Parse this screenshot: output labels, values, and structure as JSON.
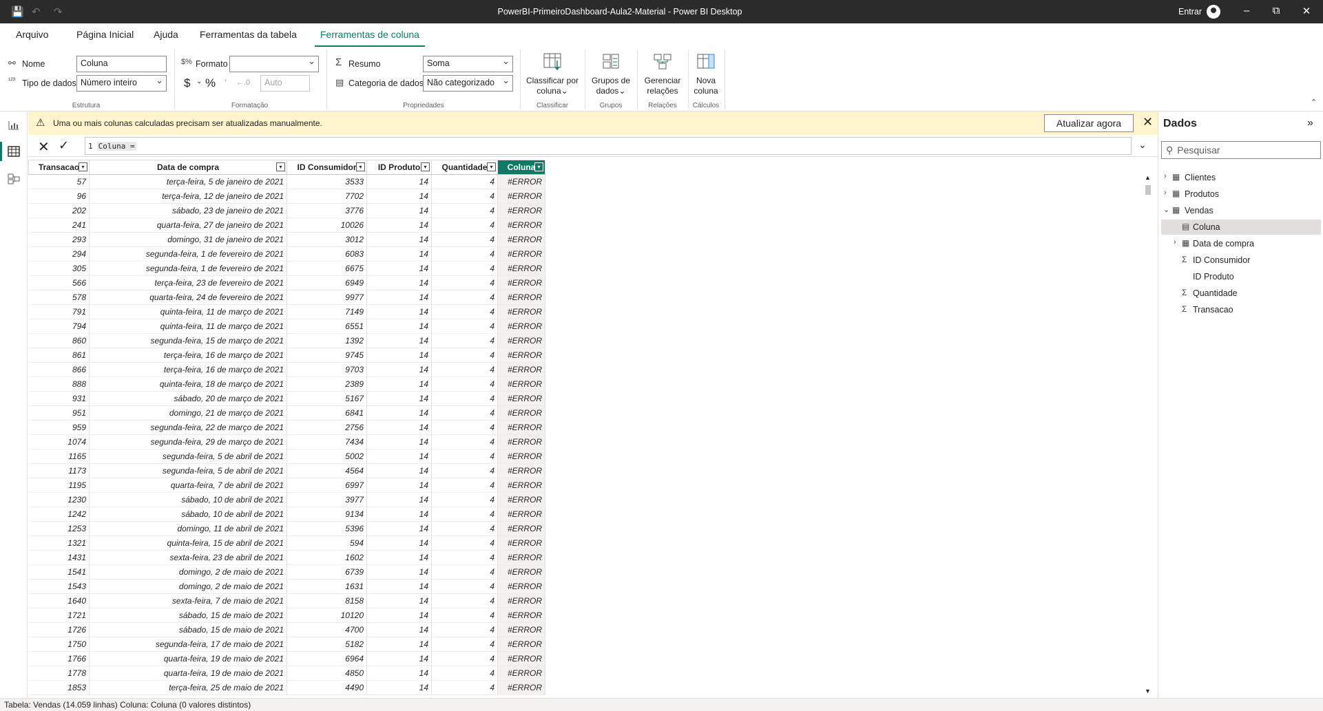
{
  "window": {
    "title": "PowerBI-PrimeiroDashboard-Aula2-Material - Power BI Desktop",
    "signin": "Entrar"
  },
  "tabs": [
    "Arquivo",
    "Página Inicial",
    "Ajuda",
    "Ferramentas da tabela",
    "Ferramentas de coluna"
  ],
  "ribbon": {
    "name_label": "Nome",
    "name_value": "Coluna",
    "datatype_label": "Tipo de dados",
    "datatype_value": "Número inteiro",
    "structure_label": "Estrutura",
    "format_label": "Formato",
    "format_value": "",
    "currency_symbol": "$",
    "percent_symbol": "%",
    "decimals_value": "Auto",
    "formatting_label": "Formatação",
    "summary_label": "Resumo",
    "summary_value": "Soma",
    "category_label": "Categoria de dados",
    "category_value": "Não categorizado",
    "properties_label": "Propriedades",
    "sort_btn_line1": "Classificar por",
    "sort_btn_line2": "coluna",
    "sort_group": "Classificar",
    "groups_btn_line1": "Grupos de",
    "groups_btn_line2": "dados",
    "groups_group": "Grupos",
    "rel_btn_line1": "Gerenciar",
    "rel_btn_line2": "relações",
    "rel_group": "Relações",
    "newcol_btn_line1": "Nova",
    "newcol_btn_line2": "coluna",
    "calc_group": "Cálculos"
  },
  "notice": {
    "message": "Uma ou mais colunas calculadas precisam ser atualizadas manualmente.",
    "button": "Atualizar agora"
  },
  "formula": {
    "line_number": "1",
    "expression": "Coluna ="
  },
  "table": {
    "headers": [
      "Transacao",
      "Data de compra",
      "ID Consumidor",
      "ID Produto",
      "Quantidade",
      "Coluna"
    ],
    "rows": [
      [
        "57",
        "terça-feira, 5 de janeiro de 2021",
        "3533",
        "14",
        "4",
        "#ERROR"
      ],
      [
        "96",
        "terça-feira, 12 de janeiro de 2021",
        "7702",
        "14",
        "4",
        "#ERROR"
      ],
      [
        "202",
        "sábado, 23 de janeiro de 2021",
        "3776",
        "14",
        "4",
        "#ERROR"
      ],
      [
        "241",
        "quarta-feira, 27 de janeiro de 2021",
        "10026",
        "14",
        "4",
        "#ERROR"
      ],
      [
        "293",
        "domingo, 31 de janeiro de 2021",
        "3012",
        "14",
        "4",
        "#ERROR"
      ],
      [
        "294",
        "segunda-feira, 1 de fevereiro de 2021",
        "6083",
        "14",
        "4",
        "#ERROR"
      ],
      [
        "305",
        "segunda-feira, 1 de fevereiro de 2021",
        "6675",
        "14",
        "4",
        "#ERROR"
      ],
      [
        "566",
        "terça-feira, 23 de fevereiro de 2021",
        "6949",
        "14",
        "4",
        "#ERROR"
      ],
      [
        "578",
        "quarta-feira, 24 de fevereiro de 2021",
        "9977",
        "14",
        "4",
        "#ERROR"
      ],
      [
        "791",
        "quinta-feira, 11 de março de 2021",
        "7149",
        "14",
        "4",
        "#ERROR"
      ],
      [
        "794",
        "quinta-feira, 11 de março de 2021",
        "6551",
        "14",
        "4",
        "#ERROR"
      ],
      [
        "860",
        "segunda-feira, 15 de março de 2021",
        "1392",
        "14",
        "4",
        "#ERROR"
      ],
      [
        "861",
        "terça-feira, 16 de março de 2021",
        "9745",
        "14",
        "4",
        "#ERROR"
      ],
      [
        "866",
        "terça-feira, 16 de março de 2021",
        "9703",
        "14",
        "4",
        "#ERROR"
      ],
      [
        "888",
        "quinta-feira, 18 de março de 2021",
        "2389",
        "14",
        "4",
        "#ERROR"
      ],
      [
        "931",
        "sábado, 20 de março de 2021",
        "5167",
        "14",
        "4",
        "#ERROR"
      ],
      [
        "951",
        "domingo, 21 de março de 2021",
        "6841",
        "14",
        "4",
        "#ERROR"
      ],
      [
        "959",
        "segunda-feira, 22 de março de 2021",
        "2756",
        "14",
        "4",
        "#ERROR"
      ],
      [
        "1074",
        "segunda-feira, 29 de março de 2021",
        "7434",
        "14",
        "4",
        "#ERROR"
      ],
      [
        "1165",
        "segunda-feira, 5 de abril de 2021",
        "5002",
        "14",
        "4",
        "#ERROR"
      ],
      [
        "1173",
        "segunda-feira, 5 de abril de 2021",
        "4564",
        "14",
        "4",
        "#ERROR"
      ],
      [
        "1195",
        "quarta-feira, 7 de abril de 2021",
        "6997",
        "14",
        "4",
        "#ERROR"
      ],
      [
        "1230",
        "sábado, 10 de abril de 2021",
        "3977",
        "14",
        "4",
        "#ERROR"
      ],
      [
        "1242",
        "sábado, 10 de abril de 2021",
        "9134",
        "14",
        "4",
        "#ERROR"
      ],
      [
        "1253",
        "domingo, 11 de abril de 2021",
        "5396",
        "14",
        "4",
        "#ERROR"
      ],
      [
        "1321",
        "quinta-feira, 15 de abril de 2021",
        "594",
        "14",
        "4",
        "#ERROR"
      ],
      [
        "1431",
        "sexta-feira, 23 de abril de 2021",
        "1602",
        "14",
        "4",
        "#ERROR"
      ],
      [
        "1541",
        "domingo, 2 de maio de 2021",
        "6739",
        "14",
        "4",
        "#ERROR"
      ],
      [
        "1543",
        "domingo, 2 de maio de 2021",
        "1631",
        "14",
        "4",
        "#ERROR"
      ],
      [
        "1640",
        "sexta-feira, 7 de maio de 2021",
        "8158",
        "14",
        "4",
        "#ERROR"
      ],
      [
        "1721",
        "sábado, 15 de maio de 2021",
        "10120",
        "14",
        "4",
        "#ERROR"
      ],
      [
        "1726",
        "sábado, 15 de maio de 2021",
        "4700",
        "14",
        "4",
        "#ERROR"
      ],
      [
        "1750",
        "segunda-feira, 17 de maio de 2021",
        "5182",
        "14",
        "4",
        "#ERROR"
      ],
      [
        "1766",
        "quarta-feira, 19 de maio de 2021",
        "6964",
        "14",
        "4",
        "#ERROR"
      ],
      [
        "1778",
        "quarta-feira, 19 de maio de 2021",
        "4850",
        "14",
        "4",
        "#ERROR"
      ],
      [
        "1853",
        "terça-feira, 25 de maio de 2021",
        "4490",
        "14",
        "4",
        "#ERROR"
      ]
    ]
  },
  "pane": {
    "title": "Dados",
    "search_placeholder": "Pesquisar",
    "tables": [
      "Clientes",
      "Produtos",
      "Vendas"
    ],
    "fields": [
      "Coluna",
      "Data de compra",
      "ID Consumidor",
      "ID Produto",
      "Quantidade",
      "Transacao"
    ]
  },
  "status": "Tabela: Vendas (14.059 linhas) Coluna: Coluna (0 valores distintos)",
  "colors": {
    "accent": "#117865",
    "notice": "#fff4ce",
    "titlebar": "#2b2b2b"
  }
}
